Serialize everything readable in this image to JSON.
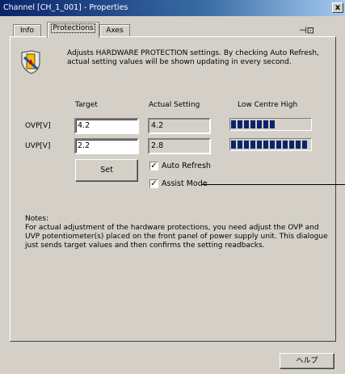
{
  "window": {
    "title": "Channel [CH_1_001] - Properties",
    "close_label": "x"
  },
  "tabs": [
    {
      "label": "Info",
      "active": false
    },
    {
      "label": "Protections",
      "active": true
    },
    {
      "label": "Axes",
      "active": false
    }
  ],
  "description": "Adjusts HARDWARE PROTECTION settings.  By checking Auto Refresh, actual setting values will be shown updating in every second.",
  "columns": {
    "target": "Target",
    "actual": "Actual Setting",
    "level": "Low  Centre  High"
  },
  "ovp": {
    "label": "OVP[V]",
    "target": "4.2",
    "actual": "4.2",
    "level_percent": 55
  },
  "uvp": {
    "label": "UVP[V]",
    "target": "2.2",
    "actual": "2.8",
    "level_percent": 97
  },
  "set_button": "Set",
  "auto_refresh": {
    "label": "Auto Refresh",
    "checked": true
  },
  "assist_mode": {
    "label": "Assist Mode",
    "checked": true
  },
  "notes": {
    "heading": "Notes:",
    "text": "For actual adjustment of the hardware protections, you need adjust the OVP and UVP potentiometer(s) placed on the front panel of power supply unit.  This dialogue just sends target values and then confirms the setting readbacks."
  },
  "help_button": "ヘルプ",
  "colors": {
    "title_bar": "#0a246a",
    "face": "#d4d0c8",
    "bar_fill": "#0a246a"
  }
}
